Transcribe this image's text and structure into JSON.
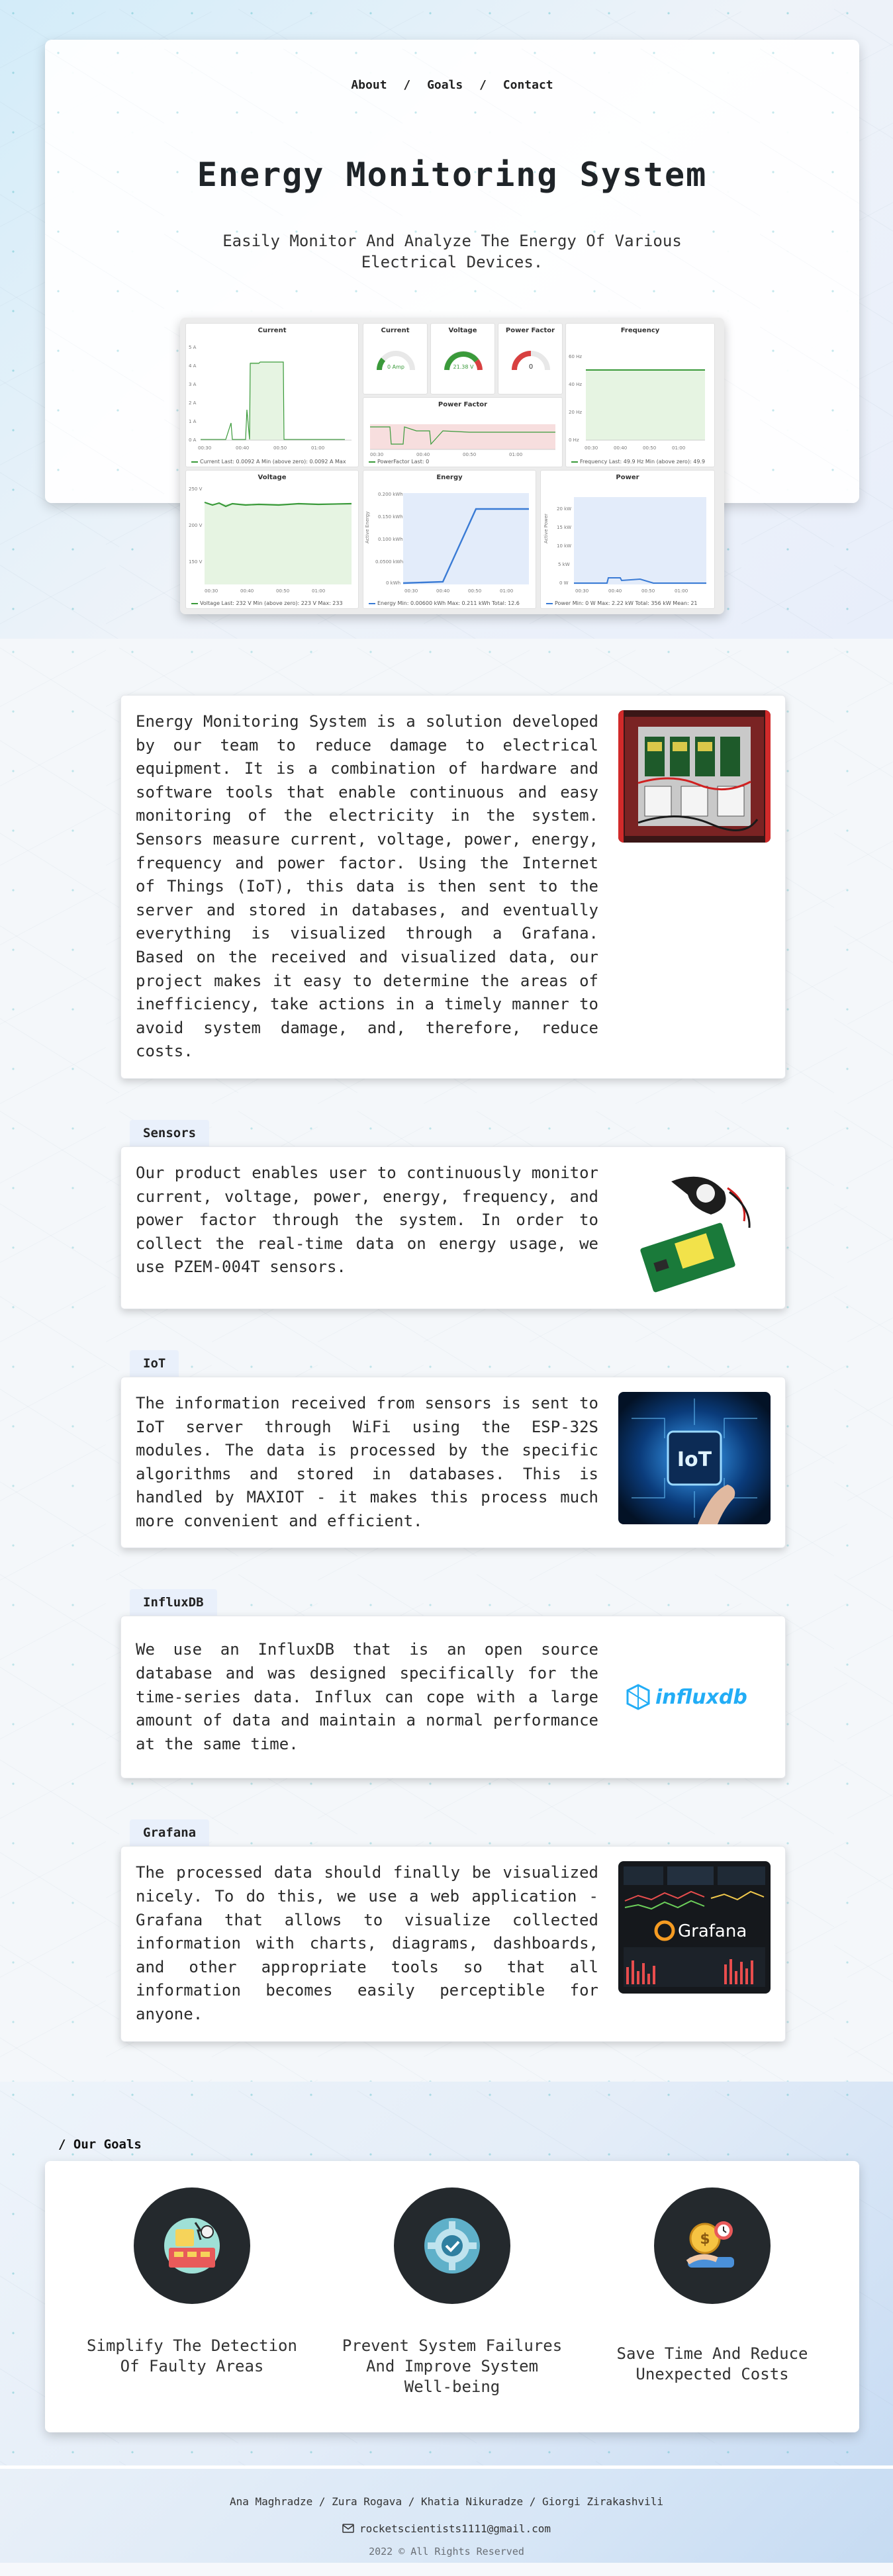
{
  "nav": {
    "about": "About",
    "goals": "Goals",
    "contact": "Contact",
    "separator": "/"
  },
  "hero": {
    "title": "Energy Monitoring System",
    "subtitle": "Easily Monitor And Analyze The Energy Of Various Electrical Devices."
  },
  "dashboard": {
    "panels": {
      "current_chart": "Current",
      "current_gauge": "Current",
      "voltage_gauge": "Voltage",
      "power_factor_gauge": "Power Factor",
      "frequency": "Frequency",
      "power_factor_chart": "Power Factor",
      "voltage_chart": "Voltage",
      "energy": "Energy",
      "power": "Power"
    },
    "gauges": {
      "current_value": "0 Amp",
      "voltage_value": "21.38 V",
      "power_factor_value": "0"
    },
    "legends": {
      "current": "Current  Last: 0.0092 A  Min (above zero): 0.0092 A  Max",
      "power_factor": "PowerFactor  Last: 0",
      "frequency": "Frequency  Last: 49.9 Hz  Min (above zero): 49.9",
      "voltage": "Voltage  Last: 232 V  Min (above zero): 223 V  Max: 233",
      "energy": "Energy  Min: 0.00600 kWh  Max: 0.211 kWh  Total: 12.6",
      "power": "Power  Min: 0 W  Max: 2.22 kW  Total: 356 kW  Mean: 21"
    },
    "axes": {
      "current_y": [
        "0 A",
        "1 A",
        "2 A",
        "3 A",
        "4 A",
        "5 A"
      ],
      "time_x": [
        "00:30",
        "00:40",
        "00:50",
        "01:00"
      ],
      "frequency_y": [
        "0 Hz",
        "20 Hz",
        "40 Hz",
        "60 Hz"
      ],
      "voltage_y": [
        "150 V",
        "200 V",
        "250 V"
      ],
      "energy_y": [
        "0 kWh",
        "0.0500 kWh",
        "0.100 kWh",
        "0.150 kWh",
        "0.200 kWh"
      ],
      "energy_label": "Active Energy",
      "power_y": [
        "0 W",
        "5 kW",
        "10 kW",
        "15 kW",
        "20 kW"
      ],
      "power_label": "Active Power"
    }
  },
  "about": {
    "text": "Energy Monitoring System is a solution developed by our team to reduce damage to electrical equipment. It is a combination of hardware and software tools that enable continuous and easy monitoring of the electricity in the system. Sensors measure current, voltage, power, energy, frequency and power factor. Using the Internet of Things (IoT), this data is then sent to the server and stored in databases, and eventually everything is visualized through a Grafana. Based on the received and visualized data, our project makes it easy to determine the areas of inefficiency, take actions in a timely manner to avoid system damage, and, therefore, reduce costs."
  },
  "sections": [
    {
      "tag": "Sensors",
      "text": "Our product enables user to continuously monitor current, voltage, power, energy, frequency, and power factor through the system. In order to collect the real-time data on energy usage, we use PZEM-004T sensors."
    },
    {
      "tag": "IoT",
      "text": "The information received from sensors is sent to IoT server through WiFi using the ESP-32S modules. The data is processed by the specific algorithms and stored in databases. This is handled by MAXIOT - it makes this process much more convenient and efficient.",
      "image_text": "IoT"
    },
    {
      "tag": "InfluxDB",
      "text": "We use an InfluxDB that is an open source database and was designed specifically for the time-series data. Influx can cope with a large amount of data and maintain a normal performance at the same time.",
      "logo_text": "influxdb"
    },
    {
      "tag": "Grafana",
      "text": "The processed data should finally be visualized nicely. To do this, we use a web application - Grafana that allows to visualize collected information with charts, diagrams, dashboards, and other appropriate tools so that all information becomes easily perceptible for anyone.",
      "logo_text": "Grafana"
    }
  ],
  "goals": {
    "title": "/ Our Goals",
    "items": [
      "Simplify The Detection Of Faulty Areas",
      "Prevent System Failures And Improve System Well-being",
      "Save Time And Reduce Unexpected Costs"
    ]
  },
  "footer": {
    "names": "Ana Maghradze / Zura Rogava / Khatia Nikuradze / Giorgi Zirakashvili",
    "email": "rocketscientists1111@gmail.com",
    "copyright": "2022 © All Rights Reserved"
  },
  "colors": {
    "accent_green": "#3a9a3a",
    "accent_blue": "#3a7bd5",
    "tag_bg": "#e9f0fb",
    "goal_circle": "#24292d"
  }
}
